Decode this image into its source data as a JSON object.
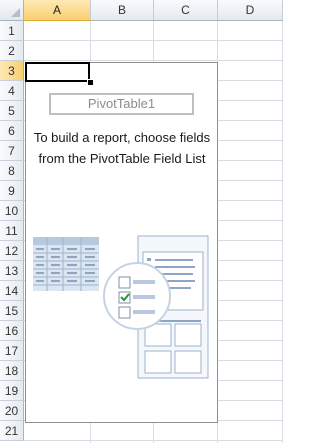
{
  "columns": [
    "A",
    "B",
    "C",
    "D"
  ],
  "selected_column": "A",
  "rows": [
    "1",
    "2",
    "3",
    "4",
    "5",
    "6",
    "7",
    "8",
    "9",
    "10",
    "11",
    "12",
    "13",
    "14",
    "15",
    "16",
    "17",
    "18",
    "19",
    "20",
    "21"
  ],
  "selected_row": "3",
  "pivot": {
    "name": "PivotTable1",
    "instruction": "To build a report, choose fields from the PivotTable Field List"
  },
  "colors": {
    "header_highlight": "#f8cf6f",
    "gridline": "#d9dde3",
    "checkbox_check": "#2f8f3a"
  },
  "icons": [
    "select-all-corner-icon",
    "pivot-table-illustration-icon",
    "checkbox-checked-icon",
    "checkbox-empty-icon"
  ]
}
